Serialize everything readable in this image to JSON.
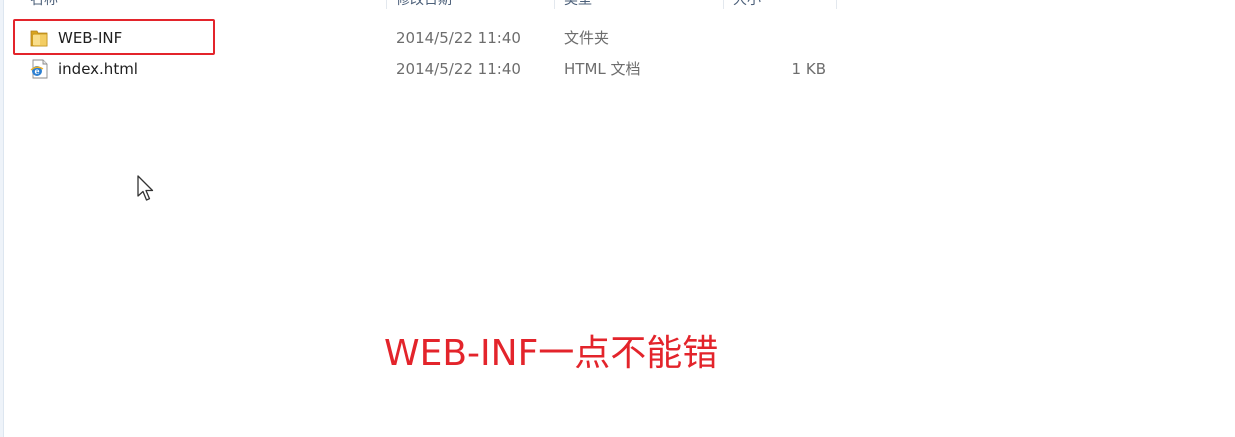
{
  "header": {
    "columns": [
      {
        "label": "名称"
      },
      {
        "label": "修改日期"
      },
      {
        "label": "类型"
      },
      {
        "label": "大小"
      }
    ]
  },
  "files": [
    {
      "name": "WEB-INF",
      "modified": "2014/5/22 11:40",
      "type": "文件夹",
      "size": "",
      "icon": "folder-icon"
    },
    {
      "name": "index.html",
      "modified": "2014/5/22 11:40",
      "type": "HTML 文档",
      "size": "1 KB",
      "icon": "html-file-icon"
    }
  ],
  "annotation": {
    "text": "WEB-INF一点不能错"
  },
  "colors": {
    "highlight": "#e3242b",
    "annotation": "#e3242b"
  }
}
